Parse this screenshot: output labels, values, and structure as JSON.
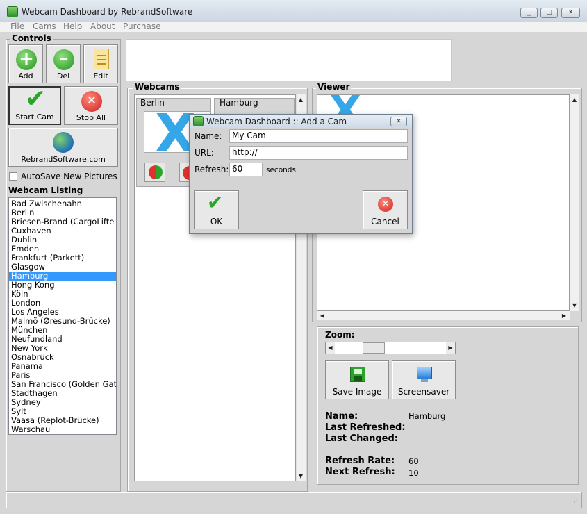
{
  "window": {
    "title": "Webcam Dashboard by RebrandSoftware",
    "min": "▁",
    "max": "▢",
    "close": "✕"
  },
  "menu": [
    "File",
    "Cams",
    "Help",
    "About",
    "Purchase"
  ],
  "controls": {
    "label": "Controls",
    "add": "Add",
    "del": "Del",
    "edit": "Edit",
    "start": "Start Cam",
    "stop": "Stop All",
    "site": "RebrandSoftware.com",
    "autosave": "AutoSave New Pictures"
  },
  "listing": {
    "label": "Webcam Listing",
    "items": [
      "Bad Zwischenahn",
      "Berlin",
      "Briesen-Brand (CargoLifte",
      "Cuxhaven",
      "Dublin",
      "Emden",
      "Frankfurt (Parkett)",
      "Glasgow",
      "Hamburg",
      "Hong Kong",
      "Köln",
      "London",
      "Los Angeles",
      "Malmö (Øresund-Brücke)",
      "München",
      "Neufundland",
      "New York",
      "Osnabrück",
      "Panama",
      "Paris",
      "San Francisco (Golden Gat",
      "Stadthagen",
      "Sydney",
      "Sylt",
      "Vaasa (Replot-Brücke)",
      "Warschau"
    ],
    "selected": 8
  },
  "webcams": {
    "label": "Webcams",
    "cams": [
      "Berlin",
      "Hamburg"
    ]
  },
  "viewer": {
    "label": "Viewer"
  },
  "dialog": {
    "title": "Webcam Dashboard :: Add a Cam",
    "name_label": "Name:",
    "name_value": "My Cam",
    "url_label": "URL:",
    "url_value": "http://",
    "refresh_label": "Refresh:",
    "refresh_value": "60",
    "seconds": "seconds",
    "ok": "OK",
    "cancel": "Cancel"
  },
  "zoom": {
    "label": "Zoom:",
    "level": 0.13
  },
  "actions": {
    "save": "Save Image",
    "screensaver": "Screensaver"
  },
  "details": {
    "name_label": "Name:",
    "name_value": "Hamburg",
    "last_refreshed_label": "Last Refreshed:",
    "last_changed_label": "Last Changed:",
    "refresh_rate_label": "Refresh Rate:",
    "refresh_rate_value": "60",
    "next_refresh_label": "Next Refresh:",
    "next_refresh_value": "10"
  },
  "colors": {
    "accent": "#3399ff",
    "green": "#2aa52a",
    "red": "#e03030",
    "x_mark": "#35a7e8"
  },
  "icons": {
    "add": "plus-circle-icon",
    "del": "minus-circle-icon",
    "edit": "notepad-icon",
    "start": "checkmark-icon",
    "stop": "x-circle-icon",
    "site": "globe-icon",
    "save": "floppy-disk-icon",
    "screensaver": "monitor-icon"
  }
}
